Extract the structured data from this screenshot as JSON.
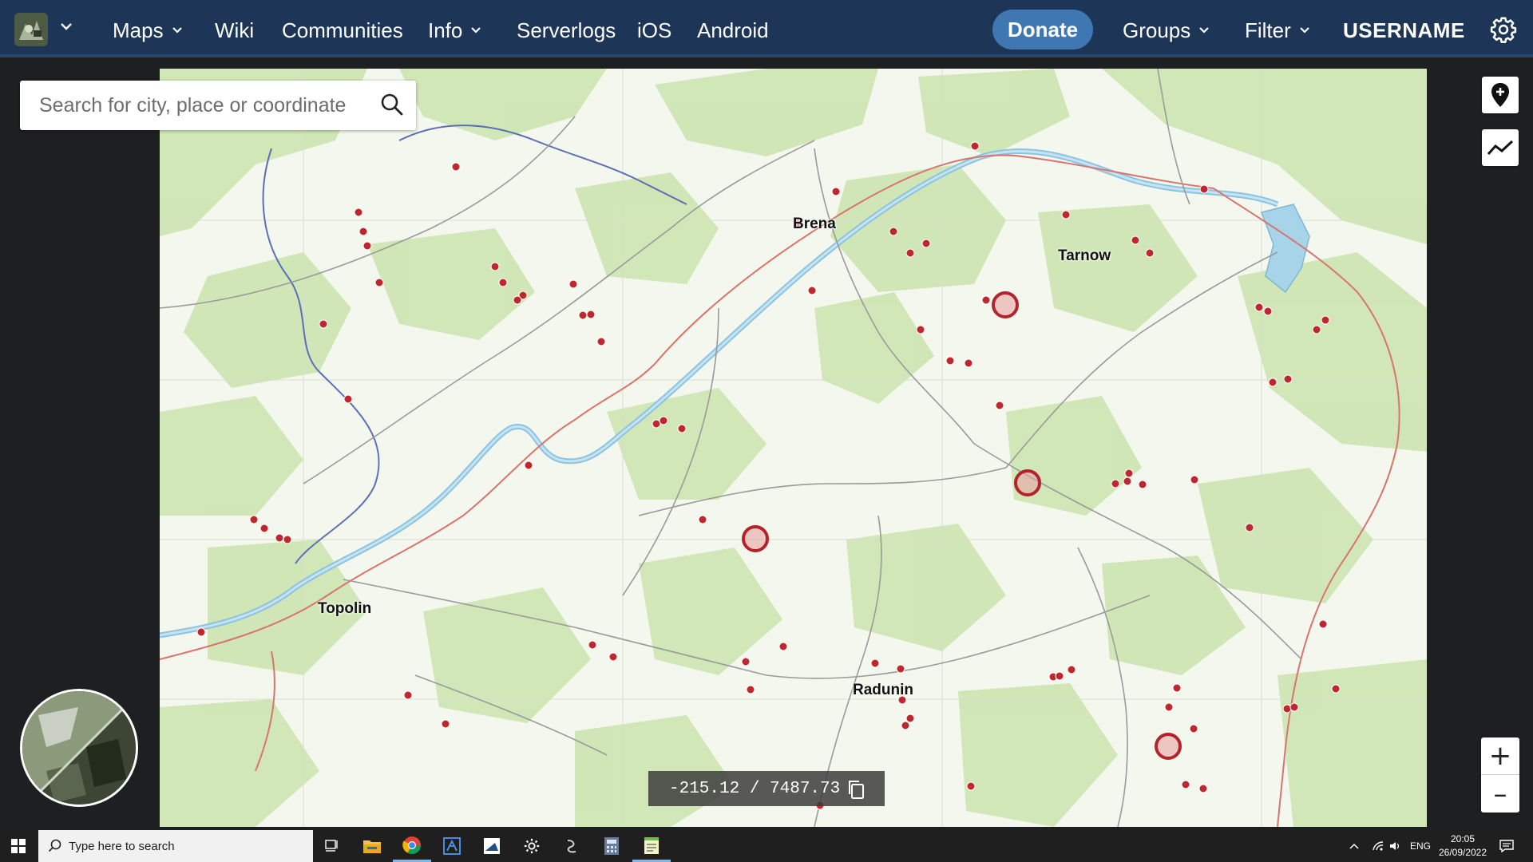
{
  "nav": {
    "items": [
      {
        "label": "Maps",
        "has_dropdown": true
      },
      {
        "label": "Wiki",
        "has_dropdown": false
      },
      {
        "label": "Communities",
        "has_dropdown": false
      },
      {
        "label": "Info",
        "has_dropdown": true
      },
      {
        "label": "Serverlogs",
        "has_dropdown": false
      },
      {
        "label": "iOS",
        "has_dropdown": false
      },
      {
        "label": "Android",
        "has_dropdown": false
      }
    ],
    "donate_label": "Donate",
    "groups_label": "Groups",
    "filter_label": "Filter",
    "username": "USERNAME",
    "colors": {
      "bar": "#1d3557",
      "donate": "#3f77b3"
    }
  },
  "search": {
    "placeholder": "Search for city, place or coordinate",
    "value": ""
  },
  "map": {
    "towns": [
      "Brena",
      "Tarnow",
      "Topolin",
      "Radunin"
    ],
    "coordinate_readout": "-215.12 / 7487.73",
    "zoom_in_label": "+",
    "zoom_out_label": "–",
    "marker_color": "#c0262d",
    "water_color": "#a8d4ea",
    "forest_color": "#cfe6b4"
  },
  "taskbar": {
    "search_placeholder": "Type here to search",
    "language": "ENG",
    "time": "20:05",
    "date": "26/09/2022"
  }
}
